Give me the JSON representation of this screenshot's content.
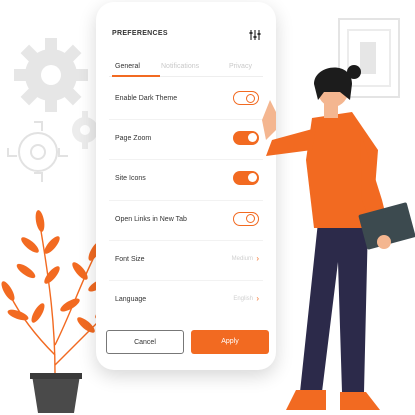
{
  "header": {
    "title": "PREFERENCES",
    "settings_icon": "sliders-icon"
  },
  "tabs": [
    {
      "label": "General",
      "active": true
    },
    {
      "label": "Notifications",
      "active": false
    },
    {
      "label": "Privacy",
      "active": false
    }
  ],
  "settings": [
    {
      "label": "Enable Dark Theme",
      "type": "toggle",
      "on": false
    },
    {
      "label": "Page Zoom",
      "type": "toggle",
      "on": true
    },
    {
      "label": "Site Icons",
      "type": "toggle",
      "on": true
    },
    {
      "label": "Open Links in New Tab",
      "type": "toggle",
      "on": false
    },
    {
      "label": "Font Size",
      "type": "select",
      "value": "Medium"
    },
    {
      "label": "Language",
      "type": "select",
      "value": "English"
    }
  ],
  "actions": {
    "cancel_label": "Cancel",
    "apply_label": "Apply"
  },
  "colors": {
    "accent": "#f26a21",
    "person_shirt": "#f26a21",
    "person_pants": "#2c2a4a",
    "gear": "#e6e6e6"
  }
}
